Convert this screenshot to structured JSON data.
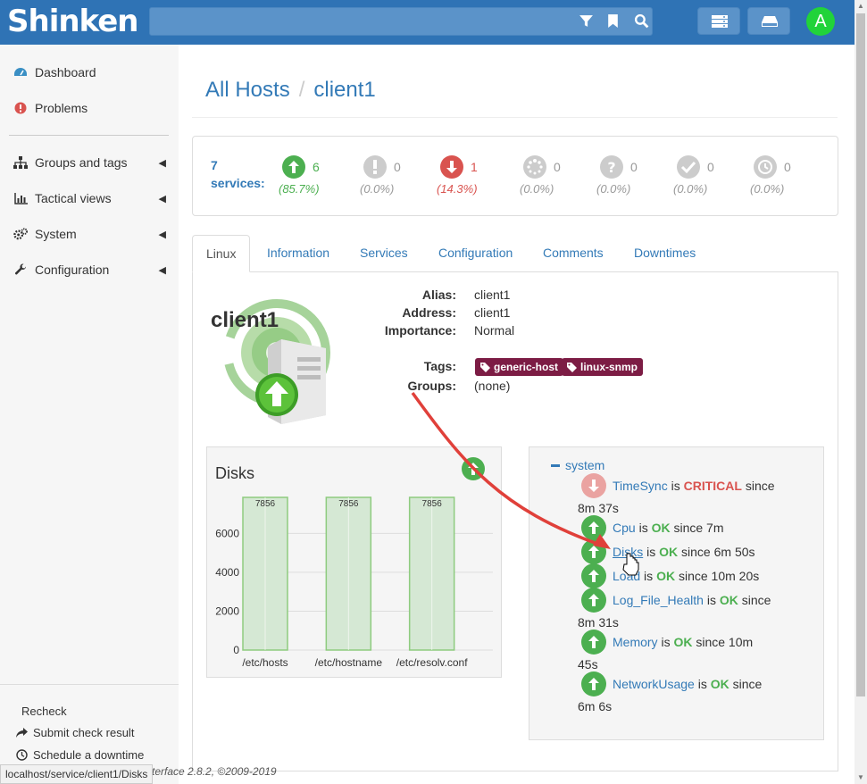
{
  "topbar": {
    "logo": "Shinken",
    "avatar_letter": "A",
    "icons": [
      "filter-icon",
      "bookmark-icon",
      "search-icon",
      "server-stack-icon",
      "hdd-icon"
    ]
  },
  "sidebar": {
    "items": [
      {
        "label": "Dashboard",
        "icon": "dashboard-icon"
      },
      {
        "label": "Problems",
        "icon": "exclamation-icon"
      },
      {
        "label": "Groups and tags",
        "icon": "sitemap-icon"
      },
      {
        "label": "Tactical views",
        "icon": "bar-chart-icon"
      },
      {
        "label": "System",
        "icon": "cogs-icon"
      },
      {
        "label": "Configuration",
        "icon": "wrench-icon"
      }
    ],
    "actions": {
      "recheck": "Recheck",
      "submit": "Submit check result",
      "schedule": "Schedule a downtime"
    }
  },
  "breadcrumb": {
    "root": "All Hosts",
    "sep": "/",
    "current": "client1"
  },
  "services_summary": {
    "count_label": "7",
    "services_label": "services:",
    "stats": [
      {
        "state": "ok",
        "count": "6",
        "pct": "(85.7%)",
        "color": "#4caf50"
      },
      {
        "state": "warning",
        "count": "0",
        "pct": "(0.0%)",
        "color": "#cccccc"
      },
      {
        "state": "critical",
        "count": "1",
        "pct": "(14.3%)",
        "color": "#d9534f"
      },
      {
        "state": "pending",
        "count": "0",
        "pct": "(0.0%)",
        "color": "#cccccc"
      },
      {
        "state": "unknown",
        "count": "0",
        "pct": "(0.0%)",
        "color": "#cccccc"
      },
      {
        "state": "ack",
        "count": "0",
        "pct": "(0.0%)",
        "color": "#cccccc"
      },
      {
        "state": "downtime",
        "count": "0",
        "pct": "(0.0%)",
        "color": "#cccccc"
      }
    ]
  },
  "tabs": [
    "Linux",
    "Information",
    "Services",
    "Configuration",
    "Comments",
    "Downtimes"
  ],
  "host": {
    "name": "client1",
    "alias_label": "Alias:",
    "alias": "client1",
    "address_label": "Address:",
    "address": "client1",
    "importance_label": "Importance:",
    "importance": "Normal",
    "tags_label": "Tags:",
    "tags": [
      "generic-host",
      "linux-snmp"
    ],
    "groups_label": "Groups:",
    "groups": "(none)"
  },
  "disks": {
    "title": "Disks"
  },
  "chart_data": {
    "type": "bar",
    "title": "Disks",
    "categories": [
      "/etc/hosts",
      "/etc/hostname",
      "/etc/resolv.conf"
    ],
    "values": [
      7856,
      7856,
      7856
    ],
    "data_labels": [
      "7856",
      "7856",
      "7856"
    ],
    "yticks": [
      "0",
      "2000",
      "4000",
      "6000"
    ],
    "ylim": [
      0,
      7856
    ],
    "grid": true,
    "bar_color": "#d5e8d4"
  },
  "tree": {
    "root": "system",
    "services": [
      {
        "name": "TimeSync",
        "is": "is",
        "state": "CRITICAL",
        "since": "since",
        "duration": "8m 37s",
        "status": "critical"
      },
      {
        "name": "Cpu",
        "is": "is",
        "state": "OK",
        "since": "since",
        "duration": "7m",
        "status": "ok"
      },
      {
        "name": "Disks",
        "is": "is",
        "state": "OK",
        "since": "since",
        "duration": "6m 50s",
        "status": "ok"
      },
      {
        "name": "Load",
        "is": "is",
        "state": "OK",
        "since": "since",
        "duration": "10m 20s",
        "status": "ok"
      },
      {
        "name": "Log_File_Health",
        "is": "is",
        "state": "OK",
        "since": "since",
        "duration": "8m 31s",
        "status": "ok"
      },
      {
        "name": "Memory",
        "is": "is",
        "state": "OK",
        "since": "since",
        "duration": "10m 45s",
        "status": "ok"
      },
      {
        "name": "NetworkUsage",
        "is": "is",
        "state": "OK",
        "since": "since",
        "duration": "6m 6s",
        "status": "ok"
      }
    ]
  },
  "footer": "terface 2.8.2, ©2009-2019",
  "status_url": "localhost/service/client1/Disks"
}
